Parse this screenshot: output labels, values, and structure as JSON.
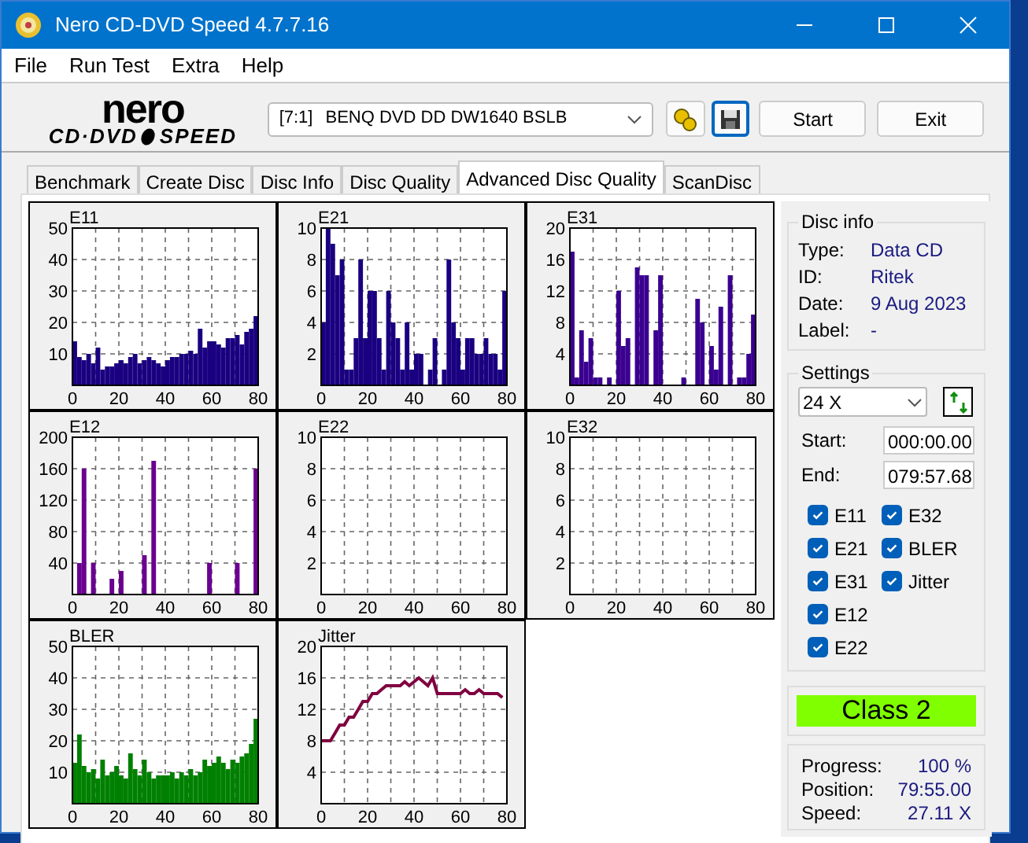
{
  "window": {
    "title": "Nero CD-DVD Speed 4.7.7.16"
  },
  "menu": [
    "File",
    "Run Test",
    "Extra",
    "Help"
  ],
  "logo": {
    "top": "nero",
    "bottom_left": "CD·DVD",
    "bottom_right": "SPEED"
  },
  "drive": {
    "id": "[7:1]",
    "name": "BENQ DVD DD DW1640 BSLB"
  },
  "buttons": [
    "Start",
    "Exit"
  ],
  "tabs": [
    {
      "label": "Benchmark",
      "selected": false
    },
    {
      "label": "Create Disc",
      "selected": false
    },
    {
      "label": "Disc Info",
      "selected": false
    },
    {
      "label": "Disc Quality",
      "selected": false
    },
    {
      "label": "Advanced Disc Quality",
      "selected": true
    },
    {
      "label": "ScanDisc",
      "selected": false
    }
  ],
  "charts": [
    {
      "chart_data": {
        "type": "bar",
        "title": "E11",
        "xlim": [
          0,
          80
        ],
        "ylim": [
          0,
          50
        ],
        "xticks": [
          0,
          20,
          40,
          60,
          80
        ],
        "yticks": [
          10,
          20,
          30,
          40,
          50
        ],
        "x": [
          0,
          2,
          4,
          6,
          8,
          10,
          12,
          14,
          16,
          18,
          20,
          22,
          24,
          26,
          28,
          30,
          32,
          34,
          36,
          38,
          40,
          42,
          44,
          46,
          48,
          50,
          52,
          54,
          56,
          58,
          60,
          62,
          64,
          66,
          68,
          70,
          72,
          74,
          76,
          78
        ],
        "grid": true,
        "series": [
          {
            "color": "#1a0080",
            "values": [
              14,
              9,
              8,
              10,
              7,
              12,
              5,
              6,
              6,
              7,
              8,
              7,
              9,
              10,
              7,
              8,
              9,
              8,
              7,
              6,
              8,
              9,
              9,
              10,
              10,
              11,
              10,
              18,
              12,
              14,
              14,
              13,
              12,
              15,
              15,
              16,
              13,
              17,
              18,
              22
            ]
          }
        ]
      }
    },
    {
      "chart_data": {
        "type": "bar",
        "title": "E21",
        "xlim": [
          0,
          80
        ],
        "ylim": [
          0,
          10
        ],
        "xticks": [
          0,
          20,
          40,
          60,
          80
        ],
        "yticks": [
          2,
          4,
          6,
          8,
          10
        ],
        "x": [
          0,
          2,
          4,
          6,
          8,
          10,
          12,
          14,
          16,
          18,
          20,
          22,
          24,
          26,
          28,
          30,
          32,
          34,
          36,
          38,
          40,
          42,
          44,
          46,
          48,
          50,
          52,
          54,
          56,
          58,
          60,
          62,
          64,
          66,
          68,
          70,
          72,
          74,
          76,
          78
        ],
        "grid": true,
        "series": [
          {
            "color": "#1a0080",
            "values": [
              4,
              10,
              9,
              7,
              8,
              1,
              1,
              3,
              8,
              3,
              6,
              6,
              3,
              1,
              6,
              4,
              3,
              1,
              4,
              1,
              2,
              2,
              0,
              1,
              3,
              0,
              1,
              8,
              4,
              3,
              1,
              3,
              3,
              2,
              2,
              3,
              2,
              2,
              1,
              6
            ]
          }
        ]
      }
    },
    {
      "chart_data": {
        "type": "bar",
        "title": "E31",
        "xlim": [
          0,
          80
        ],
        "ylim": [
          0,
          20
        ],
        "xticks": [
          0,
          20,
          40,
          60,
          80
        ],
        "yticks": [
          4,
          8,
          12,
          16,
          20
        ],
        "x": [
          0,
          2,
          4,
          6,
          8,
          10,
          12,
          14,
          16,
          18,
          20,
          22,
          24,
          26,
          28,
          30,
          32,
          34,
          36,
          38,
          40,
          42,
          44,
          46,
          48,
          50,
          52,
          54,
          56,
          58,
          60,
          62,
          64,
          66,
          68,
          70,
          72,
          74,
          76,
          78
        ],
        "grid": true,
        "series": [
          {
            "color": "#3a0090",
            "values": [
              17,
              1,
              7,
              3,
              6,
              1,
              1,
              0,
              1,
              0,
              12,
              5,
              6,
              0,
              15,
              14,
              14,
              0,
              7,
              14,
              0,
              0,
              0,
              0,
              1,
              0,
              0,
              11,
              8,
              0,
              5,
              2,
              10,
              0,
              14,
              0,
              1,
              1,
              4,
              9
            ]
          }
        ]
      }
    },
    {
      "chart_data": {
        "type": "bar",
        "title": "E12",
        "xlim": [
          0,
          80
        ],
        "ylim": [
          0,
          200
        ],
        "xticks": [
          0,
          20,
          40,
          60,
          80
        ],
        "yticks": [
          40,
          80,
          120,
          160,
          200
        ],
        "x": [
          0,
          2,
          4,
          6,
          8,
          10,
          12,
          14,
          16,
          18,
          20,
          22,
          24,
          26,
          28,
          30,
          32,
          34,
          36,
          38,
          40,
          42,
          44,
          46,
          48,
          50,
          52,
          54,
          56,
          58,
          60,
          62,
          64,
          66,
          68,
          70,
          72,
          74,
          76,
          78
        ],
        "grid": true,
        "series": [
          {
            "color": "#6a0090",
            "values": [
              0,
              40,
              160,
              0,
              40,
              0,
              0,
              0,
              20,
              0,
              30,
              0,
              0,
              0,
              0,
              50,
              0,
              170,
              0,
              0,
              0,
              0,
              0,
              0,
              0,
              0,
              0,
              0,
              0,
              40,
              0,
              0,
              0,
              0,
              0,
              40,
              0,
              0,
              0,
              160
            ]
          }
        ]
      }
    },
    {
      "chart_data": {
        "type": "bar",
        "title": "E22",
        "xlim": [
          0,
          80
        ],
        "ylim": [
          0,
          10
        ],
        "xticks": [
          0,
          20,
          40,
          60,
          80
        ],
        "yticks": [
          2,
          4,
          6,
          8,
          10
        ],
        "grid": true
      }
    },
    {
      "chart_data": {
        "type": "bar",
        "title": "E32",
        "xlim": [
          0,
          80
        ],
        "ylim": [
          0,
          10
        ],
        "xticks": [
          0,
          20,
          40,
          60,
          80
        ],
        "yticks": [
          2,
          4,
          6,
          8,
          10
        ],
        "grid": true
      }
    },
    {
      "chart_data": {
        "type": "bar",
        "title": "BLER",
        "xlim": [
          0,
          80
        ],
        "ylim": [
          0,
          50
        ],
        "xticks": [
          0,
          20,
          40,
          60,
          80
        ],
        "yticks": [
          10,
          20,
          30,
          40,
          50
        ],
        "x": [
          0,
          2,
          4,
          6,
          8,
          10,
          12,
          14,
          16,
          18,
          20,
          22,
          24,
          26,
          28,
          30,
          32,
          34,
          36,
          38,
          40,
          42,
          44,
          46,
          48,
          50,
          52,
          54,
          56,
          58,
          60,
          62,
          64,
          66,
          68,
          70,
          72,
          74,
          76,
          78
        ],
        "grid": true,
        "series": [
          {
            "color": "#008000",
            "values": [
              13,
              22,
              12,
              10,
              11,
              8,
              14,
              9,
              10,
              12,
              9,
              8,
              16,
              11,
              9,
              14,
              10,
              8,
              9,
              9,
              9,
              10,
              8,
              10,
              9,
              11,
              9,
              10,
              14,
              12,
              13,
              15,
              13,
              11,
              14,
              13,
              15,
              16,
              19,
              27
            ]
          }
        ]
      }
    },
    {
      "chart_data": {
        "type": "line",
        "title": "Jitter",
        "xlim": [
          0,
          80
        ],
        "ylim": [
          0,
          20
        ],
        "xticks": [
          0,
          20,
          40,
          60,
          80
        ],
        "yticks": [
          4,
          8,
          12,
          16,
          20
        ],
        "x": [
          0,
          2,
          4,
          6,
          8,
          10,
          12,
          14,
          16,
          18,
          20,
          22,
          24,
          26,
          28,
          30,
          32,
          34,
          36,
          38,
          40,
          42,
          44,
          46,
          48,
          50,
          52,
          54,
          56,
          58,
          60,
          62,
          64,
          66,
          68,
          70,
          72,
          74,
          76,
          78
        ],
        "grid": true,
        "series": [
          {
            "color": "#800040",
            "values": [
              8,
              8,
              8,
              9,
              10,
              10,
              11,
              11,
              12,
              13,
              13,
              14,
              14,
              14.5,
              15,
              15,
              15,
              15,
              15.5,
              15,
              15.5,
              16,
              15.5,
              15,
              16,
              14,
              14,
              14,
              14,
              14,
              14,
              14.5,
              14,
              14,
              14.5,
              14,
              14,
              14,
              14,
              13.5
            ]
          }
        ]
      }
    }
  ],
  "disc_info": {
    "title": "Disc info",
    "fields": [
      {
        "label": "Type:",
        "value": "Data CD"
      },
      {
        "label": "ID:",
        "value": "Ritek"
      },
      {
        "label": "Date:",
        "value": "9 Aug 2023"
      },
      {
        "label": "Label:",
        "value": "-"
      }
    ]
  },
  "settings": {
    "title": "Settings",
    "speed": "24 X",
    "start_label": "Start:",
    "start": "000:00.00",
    "end_label": "End:",
    "end": "079:57.68",
    "checks": [
      {
        "label": "E11",
        "checked": true
      },
      {
        "label": "E21",
        "checked": true
      },
      {
        "label": "E31",
        "checked": true
      },
      {
        "label": "E12",
        "checked": true
      },
      {
        "label": "E22",
        "checked": true
      },
      {
        "label": "E32",
        "checked": true
      },
      {
        "label": "BLER",
        "checked": true
      },
      {
        "label": "Jitter",
        "checked": true
      }
    ]
  },
  "result": {
    "label": "Class 2",
    "color": "#80ff00"
  },
  "progress": [
    {
      "label": "Progress:",
      "value": "100 %"
    },
    {
      "label": "Position:",
      "value": "79:55.00"
    },
    {
      "label": "Speed:",
      "value": "27.11 X"
    }
  ]
}
